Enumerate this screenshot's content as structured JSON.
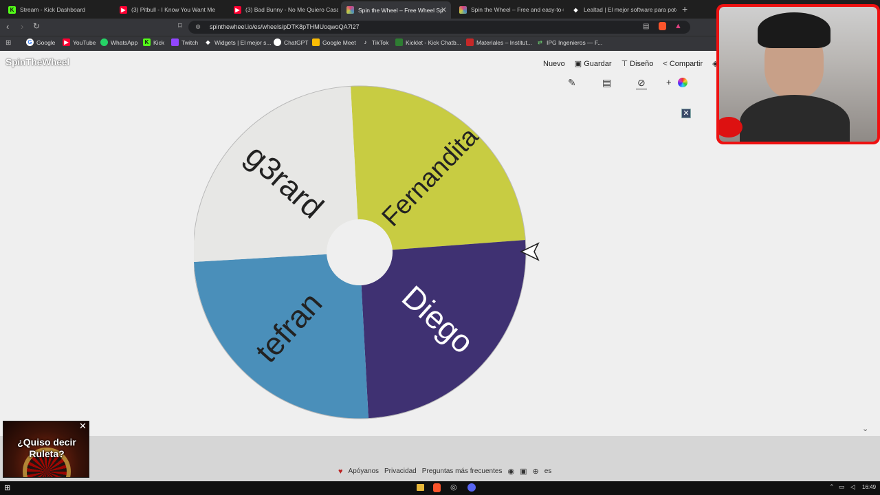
{
  "browser": {
    "tabs": [
      {
        "title": "Stream - Kick Dashboard",
        "color": "#53fc18"
      },
      {
        "title": "(3) Pitbull - I Know You Want Me",
        "color": "#ff0033"
      },
      {
        "title": "(3) Bad Bunny - No Me Quiero Casar",
        "color": "#ff0033"
      },
      {
        "title": "Spin the Wheel – Free Wheel Sp",
        "color": "#e04080",
        "active": true
      },
      {
        "title": "Spin the Wheel – Free and easy-to-u",
        "color": "#e04080"
      },
      {
        "title": "Lealtad | El mejor software para pote",
        "color": "#ffffff"
      }
    ],
    "url": "spinthewheel.io/es/wheels/pDTK8pTHMUoqwoQA7l27",
    "bookmarks": [
      "Google",
      "YouTube",
      "WhatsApp",
      "Kick",
      "Twitch",
      "Widgets | El mejor s...",
      "ChatGPT",
      "Google Meet",
      "TikTok",
      "Kicklet - Kick Chatb...",
      "Materiales – Institut...",
      "IPG Ingenieros — F..."
    ]
  },
  "app": {
    "logo": "SpinTheWheel",
    "menu": [
      {
        "label": "Nuevo",
        "icon": ""
      },
      {
        "label": "Guardar",
        "icon": "save-icon"
      },
      {
        "label": "Diseño",
        "icon": "paint-icon"
      },
      {
        "label": "Compartir",
        "icon": "share-icon"
      },
      {
        "label": "B",
        "icon": "layers-icon"
      }
    ],
    "tool_icons": [
      "pencil-icon",
      "list-icon",
      "eye-slash-icon",
      "plus-icon",
      "color-wheel-icon"
    ]
  },
  "wheel": {
    "segments": [
      {
        "label": "Fernandita",
        "color": "#c8cc42"
      },
      {
        "label": "Diego",
        "color": "#3f3172"
      },
      {
        "label": "tefran",
        "color": "#4a8fba"
      },
      {
        "label": "g3rard",
        "color": "#e7e7e5"
      }
    ]
  },
  "footer": {
    "links": [
      "Apóyanos",
      "Privacidad",
      "Preguntas más frecuentes",
      "es"
    ]
  },
  "ad": {
    "text_line1": "¿Quiso decir",
    "text_line2": "Ruleta?"
  },
  "taskbar": {
    "time": "16:49"
  }
}
